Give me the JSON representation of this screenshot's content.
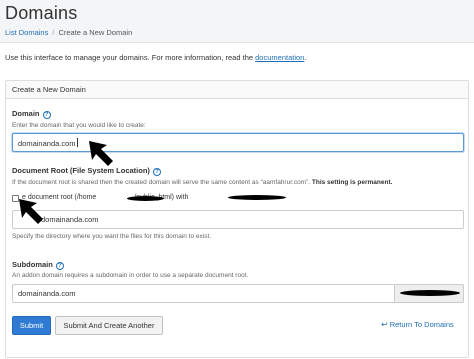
{
  "header": {
    "title": "Domains",
    "breadcrumb": {
      "parent": "List Domains",
      "separator": "/",
      "current": "Create a New Domain"
    }
  },
  "intro": {
    "text": "Use this interface to manage your domains. For more information, read the",
    "link": "documentation",
    "suffix": "."
  },
  "panel": {
    "heading": "Create a New Domain",
    "domain": {
      "label": "Domain",
      "help_icon": "question-circle-icon",
      "description": "Enter the domain that you would like to create:",
      "value": "domainanda.com"
    },
    "docroot": {
      "label": "Document Root (File System Location)",
      "help_icon": "question-circle-icon",
      "description": "If the document root is shared then the created domain will serve the same content as “aamfahrur.com”.",
      "description_bold": "This setting is permanent.",
      "checkbox_text_a": "e document root (/home",
      "checkbox_text_b": "/public_html) with",
      "checkbox_text_c": ".",
      "value": "domainanda.com",
      "hint": "Specify the directory where you want the files for this domain to exist."
    },
    "subdomain": {
      "label": "Subdomain",
      "help_icon": "question-circle-icon",
      "description": "An addon domain requires a subdomain in order to use a separate document root.",
      "value": "domainanda.com"
    },
    "buttons": {
      "submit": "Submit",
      "submit_another": "Submit And Create Another"
    },
    "return_link": "Return To Domains",
    "return_icon": "return-arrow-icon"
  },
  "colors": {
    "accent": "#2f7bd3",
    "link": "#1f6eb6",
    "redaction": "#000000"
  }
}
